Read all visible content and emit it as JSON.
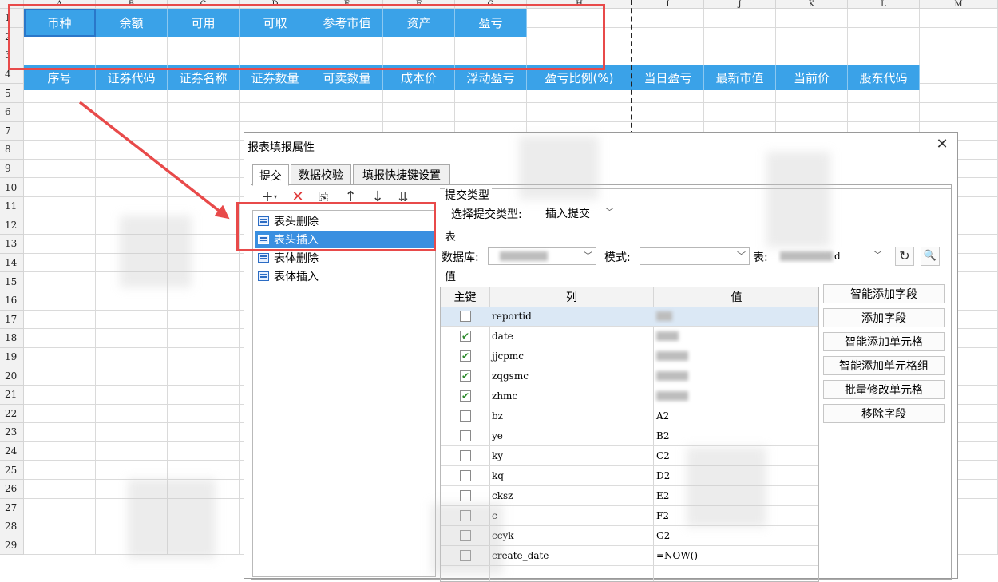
{
  "sheet": {
    "columns": [
      "A",
      "B",
      "C",
      "D",
      "E",
      "F",
      "G",
      "H",
      "I",
      "J",
      "K",
      "L",
      "M"
    ],
    "rows": [
      "1",
      "2",
      "3",
      "4",
      "5",
      "6",
      "7",
      "8",
      "9",
      "10",
      "11",
      "12",
      "13",
      "14",
      "15",
      "16",
      "17",
      "18",
      "19",
      "20",
      "21",
      "22",
      "23",
      "24",
      "25",
      "26",
      "27",
      "28",
      "29"
    ],
    "header_row_1": [
      "币种",
      "余额",
      "可用",
      "可取",
      "参考市值",
      "资产",
      "盈亏"
    ],
    "header_row_4": [
      "序号",
      "证券代码",
      "证券名称",
      "证券数量",
      "可卖数量",
      "成本价",
      "浮动盈亏",
      "盈亏比例(%)",
      "当日盈亏",
      "最新市值",
      "当前价",
      "股东代码"
    ]
  },
  "dialog": {
    "title": "报表填报属性",
    "tabs": [
      {
        "label": "提交"
      },
      {
        "label": "数据校验"
      },
      {
        "label": "填报快捷键设置"
      }
    ],
    "toolbar": {
      "icons": [
        "plus-icon",
        "delete-icon",
        "copy-icon",
        "arrow-up-icon",
        "arrow-down-icon",
        "sort-icon"
      ]
    },
    "submit_list": [
      {
        "label": "表头删除"
      },
      {
        "label": "表头插入"
      },
      {
        "label": "表体删除"
      },
      {
        "label": "表体插入"
      }
    ],
    "submit_type_section": "提交类型",
    "submit_type_label": "选择提交类型:",
    "submit_type_value": "插入提交",
    "table_section": "表",
    "database_label": "数据库:",
    "mode_label": "模式:",
    "table_label": "表:",
    "table_value_suffix": "d",
    "value_section": "值",
    "grid_headers": {
      "key": "主键",
      "column": "列",
      "value": "值"
    },
    "grid_rows": [
      {
        "column": "reportid",
        "value": "",
        "checked": false
      },
      {
        "column": "date",
        "value": "",
        "checked": true
      },
      {
        "column": "jjcpmc",
        "value": "",
        "checked": true
      },
      {
        "column": "zqgsmc",
        "value": "",
        "checked": true
      },
      {
        "column": "zhmc",
        "value": "",
        "checked": true
      },
      {
        "column": "bz",
        "value": "A2",
        "checked": false
      },
      {
        "column": "ye",
        "value": "B2",
        "checked": false
      },
      {
        "column": "ky",
        "value": "C2",
        "checked": false
      },
      {
        "column": "kq",
        "value": "D2",
        "checked": false
      },
      {
        "column": "cksz",
        "value": "E2",
        "checked": false
      },
      {
        "column": "c",
        "value": "F2",
        "checked": false
      },
      {
        "column": "ccyk",
        "value": "G2",
        "checked": false
      },
      {
        "column": "create_date",
        "value": "=NOW()",
        "checked": false
      }
    ],
    "buttons": [
      "智能添加字段",
      "添加字段",
      "智能添加单元格",
      "智能添加单元格组",
      "批量修改单元格",
      "移除字段"
    ]
  },
  "colors": {
    "header_blue": "#3aa2e8",
    "highlight_red": "#e84a4a",
    "selection_blue": "#3a8fe0"
  }
}
